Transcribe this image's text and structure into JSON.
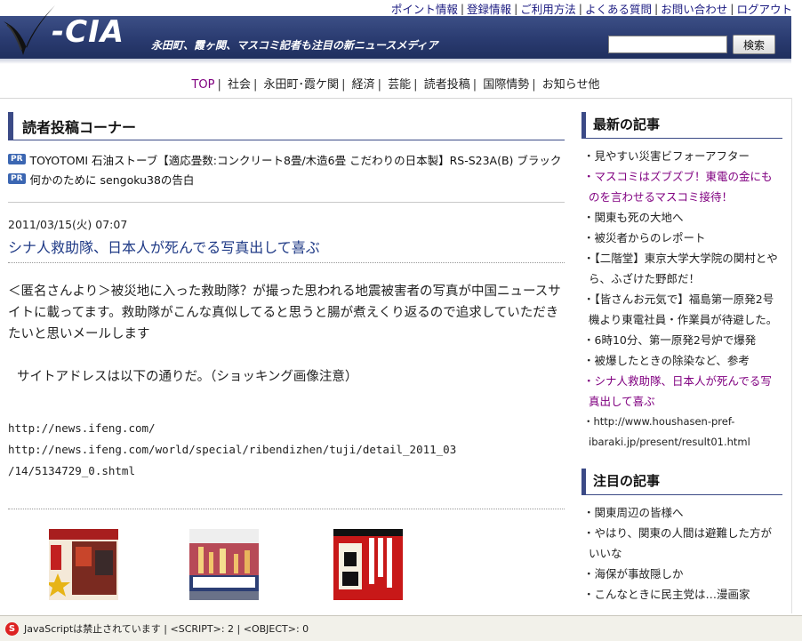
{
  "util_nav": [
    "ポイント情報",
    "登録情報",
    "ご利用方法",
    "よくある質問",
    "お問い合わせ",
    "ログアウト"
  ],
  "header": {
    "logo": "-CIA",
    "tagline": "永田町、霞ヶ関、マスコミ記者も注目の新ニュースメディア",
    "search_button": "検索"
  },
  "main_nav": [
    {
      "label": "TOP",
      "active": true
    },
    {
      "label": "社会"
    },
    {
      "label": "永田町･霞ケ関"
    },
    {
      "label": "経済"
    },
    {
      "label": "芸能"
    },
    {
      "label": "読者投稿"
    },
    {
      "label": "国際情勢"
    },
    {
      "label": "お知らせ他"
    }
  ],
  "left": {
    "section_title": "読者投稿コーナー",
    "pr_badge": "PR",
    "pr_items": [
      "TOYOTOMI 石油ストーブ【適応畳数:コンクリート8畳/木造6畳 こだわりの日本製】RS-S23A(B) ブラック",
      "何かのために sengoku38の告白"
    ],
    "post": {
      "date": "2011/03/15(火) 07:07",
      "title": "シナ人救助隊、日本人が死んでる写真出して喜ぶ",
      "body1": "＜匿名さんより＞被災地に入った救助隊？が撮った思われる地震被害者の写真が中国ニュースサイトに載ってます。救助隊がこんな真似してると思うと腸が煮えくり返るので追求していただきたいと思いメールします",
      "body2": "サイトアドレスは以下の通りだ。（ショッキング画像注意）",
      "url1": "http://news.ifeng.com/",
      "url2": "http://news.ifeng.com/world/special/ribendizhen/tuji/detail_2011_03",
      "url3": "/14/5134729_0.shtml"
    }
  },
  "right": {
    "latest_title": "最新の記事",
    "latest": [
      {
        "text": "・見やすい災害ビフォーアフター"
      },
      {
        "text": "・マスコミはズブズブ！東電の金にものを言わせるマスコミ接待！",
        "visited": true
      },
      {
        "text": "・関東も死の大地へ"
      },
      {
        "text": "・被災者からのレポート"
      },
      {
        "text": "・【二階堂】東京大学大学院の関村とやら、ふざけた野郎だ！"
      },
      {
        "text": "・【皆さんお元気で】福島第一原発2号機より東電社員・作業員が待避した。"
      },
      {
        "text": "・6時10分、第一原発2号炉で爆発"
      },
      {
        "text": "・被爆したときの除染など、参考"
      },
      {
        "text": "・シナ人救助隊、日本人が死んでる写真出して喜ぶ",
        "visited": true
      },
      {
        "text": "・http://www.houshasen-pref-ibaraki.jp/present/result01.html",
        "small": true
      }
    ],
    "featured_title": "注目の記事",
    "featured": [
      {
        "text": "・関東周辺の皆様へ"
      },
      {
        "text": "・やはり、関東の人間は避難した方がいいな"
      },
      {
        "text": "・海保が事故隠しか"
      },
      {
        "text": "・こんなときに民主党は…漫画家"
      }
    ]
  },
  "statusbar": {
    "icon": "noscript-icon",
    "text": "JavaScriptは禁止されています | <SCRIPT>: 2 | <OBJECT>: 0"
  }
}
